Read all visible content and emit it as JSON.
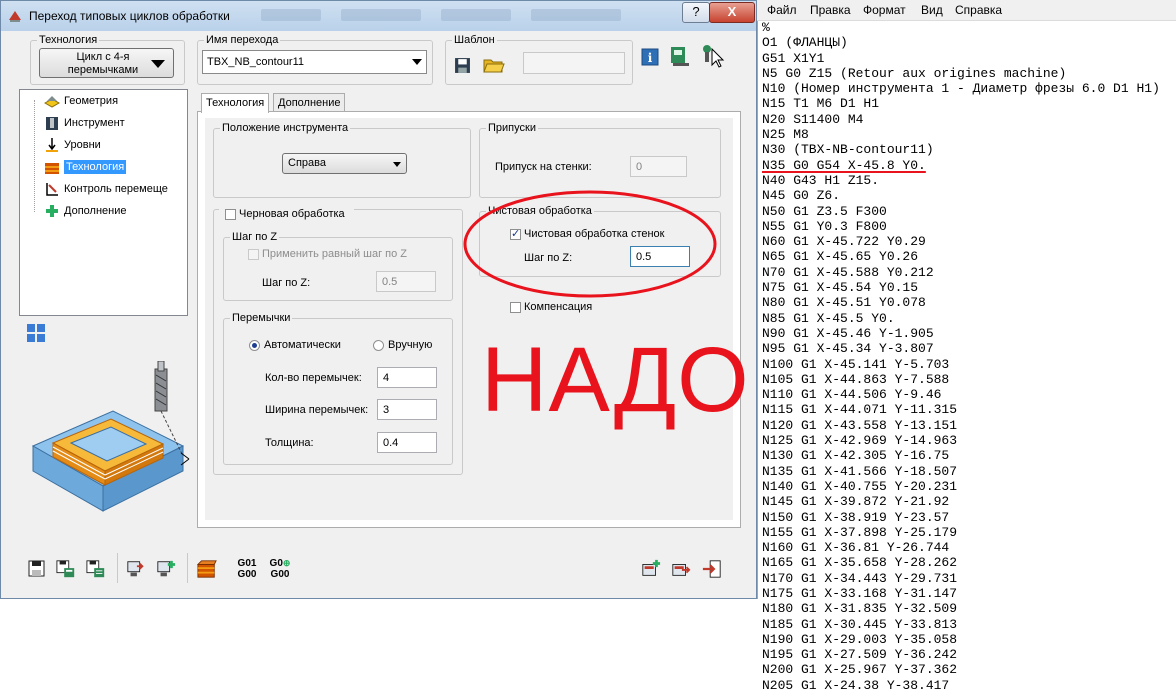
{
  "window": {
    "title": "Переход типовых циклов обработки",
    "help_label": "?",
    "close_label": "X"
  },
  "top": {
    "technology_label": "Технология",
    "technology_value": "Цикл с 4-я перемычками",
    "name_label": "Имя перехода",
    "name_value": "TBX_NB_contour11",
    "template_label": "Шаблон"
  },
  "tree": [
    {
      "label": "Геометрия",
      "icon": "geometry-icon"
    },
    {
      "label": "Инструмент",
      "icon": "tool-icon"
    },
    {
      "label": "Уровни",
      "icon": "levels-icon"
    },
    {
      "label": "Технология",
      "icon": "technology-icon",
      "selected": true
    },
    {
      "label": "Контроль перемеще",
      "icon": "motion-control-icon"
    },
    {
      "label": "Дополнение",
      "icon": "addition-icon"
    }
  ],
  "tabs": [
    "Технология",
    "Дополнение"
  ],
  "tool_position": {
    "legend": "Положение инструмента",
    "value": "Справа"
  },
  "allowances": {
    "legend": "Припуски",
    "wall_label": "Припуск на стенки:",
    "wall_value": "0"
  },
  "roughing": {
    "label": "Черновая обработка",
    "step_z_legend": "Шаг по Z",
    "equal_step_label": "Применить равный шаг по Z",
    "step_z_label": "Шаг по Z:",
    "step_z_value": "0.5"
  },
  "bridges": {
    "legend": "Перемычки",
    "auto_label": "Автоматически",
    "manual_label": "Вручную",
    "count_label": "Кол-во перемычек:",
    "count_value": "4",
    "width_label": "Ширина перемычек:",
    "width_value": "3",
    "thickness_label": "Толщина:",
    "thickness_value": "0.4"
  },
  "finishing": {
    "legend": "Чистовая обработка",
    "wall_finish_label": "Чистовая обработка стенок",
    "step_z_label": "Шаг по Z:",
    "step_z_value": "0.5"
  },
  "compensation_label": "Компенсация",
  "annotation": {
    "text": "НАДО",
    "color": "#e8131c"
  },
  "toolbar_bottom": {
    "g01_g00_top": "G01",
    "g01_g00_bottom": "G00",
    "g00_g00_top": "G0",
    "g00_g00_bottom": "G00"
  },
  "notepad": {
    "menu": [
      "Файл",
      "Правка",
      "Формат",
      "Вид",
      "Справка"
    ],
    "lines": [
      "%",
      "O1 (ФЛАНЦЫ)",
      "G51 X1Y1",
      "N5 G0 Z15 (Retour aux origines machine)",
      "N10 (Номер инструмента 1 - Диаметр фрезы 6.0 D1 H1)",
      "N15 T1 M6 D1 H1",
      "N20 S11400 M4",
      "N25 M8",
      "N30 (TBX-NB-contour11)",
      "N35 G0 G54 X-45.8 Y0.",
      "N40 G43 H1 Z15.",
      "N45 G0 Z6.",
      "N50 G1 Z3.5 F300",
      "N55 G1 Y0.3 F800",
      "N60 G1 X-45.722 Y0.29",
      "N65 G1 X-45.65 Y0.26",
      "N70 G1 X-45.588 Y0.212",
      "N75 G1 X-45.54 Y0.15",
      "N80 G1 X-45.51 Y0.078",
      "N85 G1 X-45.5 Y0.",
      "N90 G1 X-45.46 Y-1.905",
      "N95 G1 X-45.34 Y-3.807",
      "N100 G1 X-45.141 Y-5.703",
      "N105 G1 X-44.863 Y-7.588",
      "N110 G1 X-44.506 Y-9.46",
      "N115 G1 X-44.071 Y-11.315",
      "N120 G1 X-43.558 Y-13.151",
      "N125 G1 X-42.969 Y-14.963",
      "N130 G1 X-42.305 Y-16.75",
      "N135 G1 X-41.566 Y-18.507",
      "N140 G1 X-40.755 Y-20.231",
      "N145 G1 X-39.872 Y-21.92",
      "N150 G1 X-38.919 Y-23.57",
      "N155 G1 X-37.898 Y-25.179",
      "N160 G1 X-36.81 Y-26.744",
      "N165 G1 X-35.658 Y-28.262",
      "N170 G1 X-34.443 Y-29.731",
      "N175 G1 X-33.168 Y-31.147",
      "N180 G1 X-31.835 Y-32.509",
      "N185 G1 X-30.445 Y-33.813",
      "N190 G1 X-29.003 Y-35.058",
      "N195 G1 X-27.509 Y-36.242",
      "N200 G1 X-25.967 Y-37.362",
      "N205 G1 X-24.38 Y-38.417"
    ],
    "underlined_line_index": 9
  }
}
